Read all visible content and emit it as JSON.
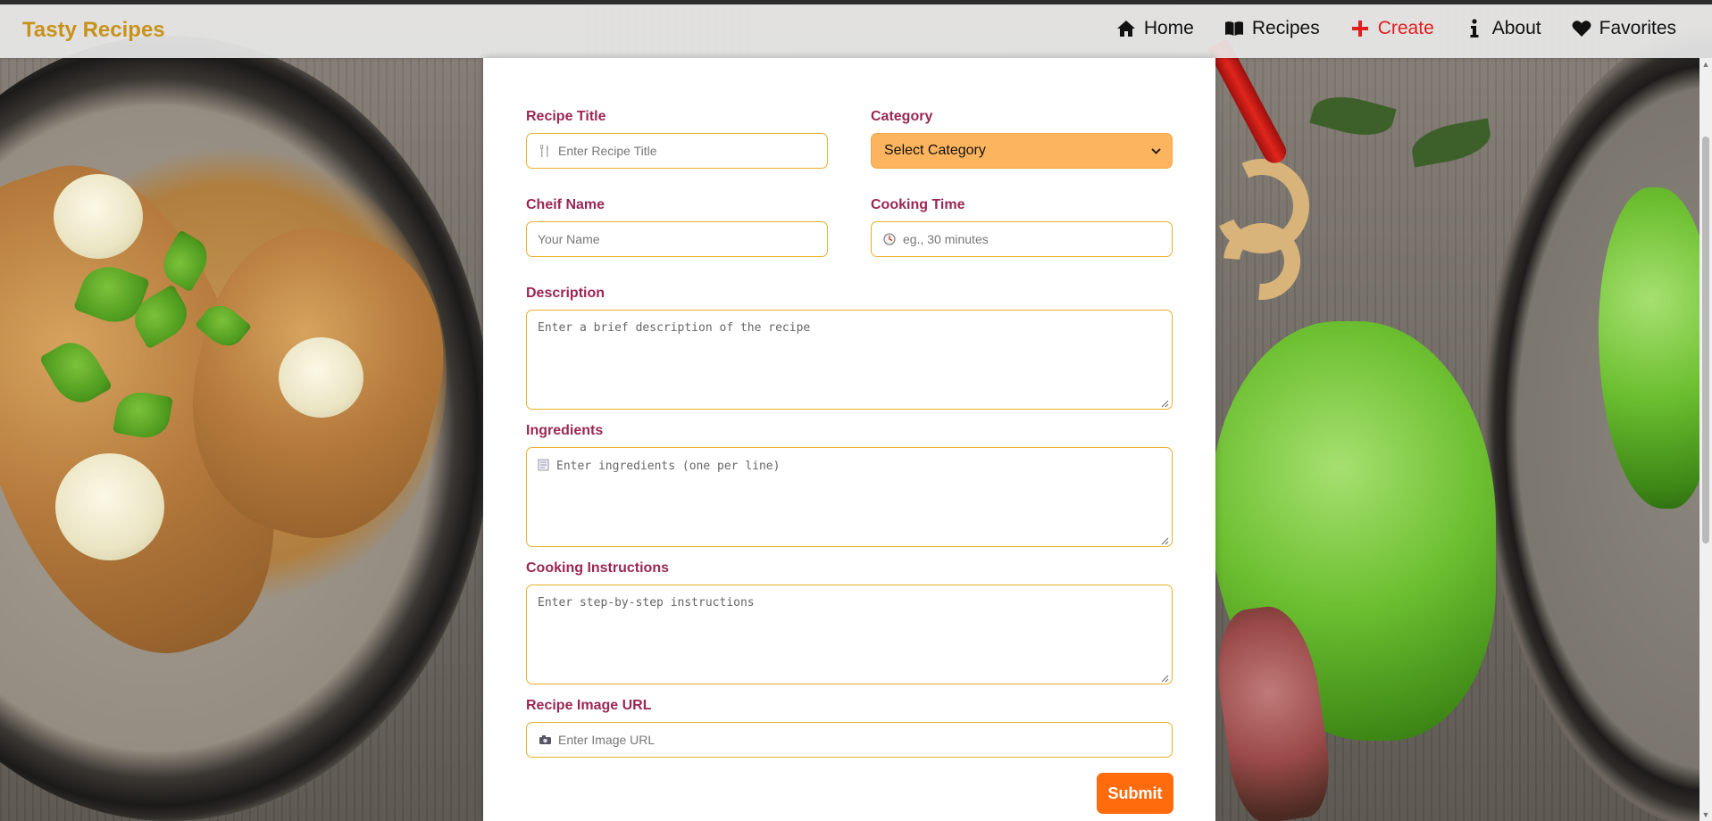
{
  "app": {
    "brand": "Tasty Recipes"
  },
  "nav": {
    "items": [
      {
        "label": "Home",
        "icon": "home-icon",
        "active": false
      },
      {
        "label": "Recipes",
        "icon": "book-icon",
        "active": false
      },
      {
        "label": "Create",
        "icon": "plus-icon",
        "active": true
      },
      {
        "label": "About",
        "icon": "info-icon",
        "active": false
      },
      {
        "label": "Favorites",
        "icon": "heart-icon",
        "active": false
      }
    ]
  },
  "form": {
    "recipe_title": {
      "label": "Recipe Title",
      "placeholder": "Enter Recipe Title",
      "icon": "utensils-icon"
    },
    "category": {
      "label": "Category",
      "selected": "Select Category"
    },
    "chef_name": {
      "label": "Cheif Name",
      "placeholder": "Your Name"
    },
    "cooking_time": {
      "label": "Cooking Time",
      "placeholder": "eg., 30 minutes",
      "icon": "clock-icon"
    },
    "description": {
      "label": "Description",
      "placeholder": "Enter a brief description of the recipe"
    },
    "ingredients": {
      "label": "Ingredients",
      "placeholder": "Enter ingredients (one per line)",
      "icon": "notepad-icon"
    },
    "instructions": {
      "label": "Cooking Instructions",
      "placeholder": "Enter step-by-step instructions"
    },
    "image_url": {
      "label": "Recipe Image URL",
      "placeholder": "Enter Image URL",
      "icon": "camera-icon"
    },
    "submit_label": "Submit"
  },
  "colors": {
    "brand": "#c8921a",
    "label": "#9a2754",
    "input_border": "#e9b02a",
    "select_bg": "#fdb45e",
    "submit_bg": "#ff6b0d",
    "nav_active": "#e11d1d"
  }
}
